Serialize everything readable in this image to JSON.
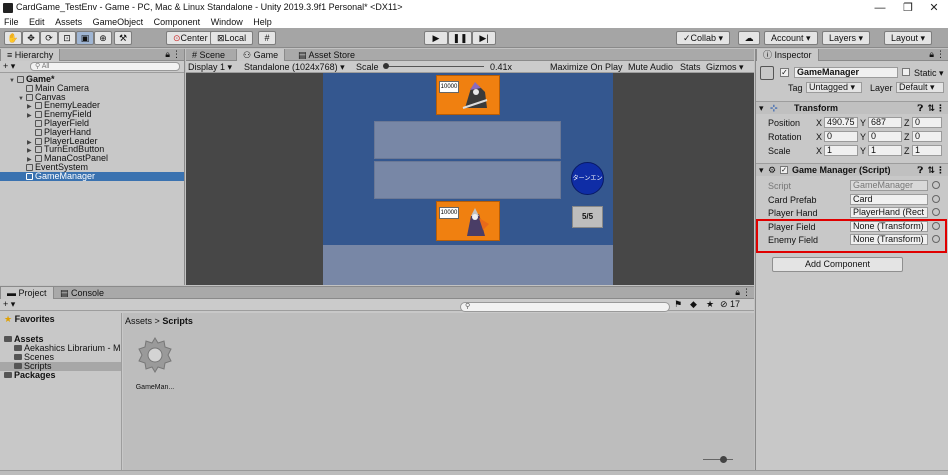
{
  "window": {
    "title": "CardGame_TestEnv - Game - PC, Mac & Linux Standalone - Unity 2019.3.9f1 Personal* <DX11>",
    "min": "—",
    "max": "❐",
    "close": "✕"
  },
  "menu": [
    "File",
    "Edit",
    "Assets",
    "GameObject",
    "Component",
    "Window",
    "Help"
  ],
  "toolbar": {
    "center": "Center",
    "local": "Local",
    "play": "▶",
    "pause": "❚❚",
    "step": "▶|",
    "collab": "Collab ▾",
    "account": "Account ▾",
    "layers": "Layers ▾",
    "layout": "Layout ▾"
  },
  "hierarchy": {
    "tab": "Hierarchy",
    "add": "+ ▾",
    "search_placeholder": "All",
    "items": [
      {
        "label": "Game*",
        "indent": 1,
        "type": "scene"
      },
      {
        "label": "Main Camera",
        "indent": 2,
        "type": "object"
      },
      {
        "label": "Canvas",
        "indent": 2,
        "type": "object"
      },
      {
        "label": "EnemyLeader",
        "indent": 3,
        "type": "object"
      },
      {
        "label": "EnemyField",
        "indent": 3,
        "type": "object"
      },
      {
        "label": "PlayerField",
        "indent": 3,
        "type": "object"
      },
      {
        "label": "PlayerHand",
        "indent": 3,
        "type": "object"
      },
      {
        "label": "PlayerLeader",
        "indent": 3,
        "type": "object"
      },
      {
        "label": "TurnEndButton",
        "indent": 3,
        "type": "object"
      },
      {
        "label": "ManaCostPanel",
        "indent": 3,
        "type": "object"
      },
      {
        "label": "EventSystem",
        "indent": 2,
        "type": "object"
      },
      {
        "label": "GameManager",
        "indent": 2,
        "type": "object"
      }
    ]
  },
  "game_view": {
    "tabs": [
      "Scene",
      "Game",
      "Asset Store"
    ],
    "display": "Display 1 ▾",
    "resolution": "Standalone (1024x768) ▾",
    "scale_label": "Scale",
    "scale_value": "0.41x",
    "options": [
      "Maximize On Play",
      "Mute Audio",
      "Stats",
      "Gizmos ▾"
    ],
    "enemy_card_cost": "10000",
    "player_card_cost": "10000",
    "turn_end_label": "ターンエンド",
    "mana": "5/5"
  },
  "inspector": {
    "tab": "Inspector",
    "object_name": "GameManager",
    "static": "Static ▾",
    "tag_label": "Tag",
    "tag_value": "Untagged ▾",
    "layer_label": "Layer",
    "layer_value": "Default ▾",
    "transform": {
      "title": "Transform",
      "position": {
        "label": "Position",
        "x": "490.75",
        "y": "687",
        "z": "0"
      },
      "rotation": {
        "label": "Rotation",
        "x": "0",
        "y": "0",
        "z": "0"
      },
      "scale": {
        "label": "Scale",
        "x": "1",
        "y": "1",
        "z": "1"
      }
    },
    "script_component": {
      "title": "Game Manager (Script)",
      "fields": [
        {
          "label": "Script",
          "value": "GameManager"
        },
        {
          "label": "Card Prefab",
          "value": "Card"
        },
        {
          "label": "Player Hand",
          "value": "PlayerHand (Rect"
        },
        {
          "label": "Player Field",
          "value": "None (Transform)"
        },
        {
          "label": "Enemy Field",
          "value": "None (Transform)"
        }
      ]
    },
    "add_component": "Add Component"
  },
  "project": {
    "tabs": [
      "Project",
      "Console"
    ],
    "add": "+ ▾",
    "count": "17",
    "tree": [
      {
        "label": "Favorites",
        "indent": 0
      },
      {
        "label": "Assets",
        "indent": 0
      },
      {
        "label": "Aekashics Librarium - M",
        "indent": 1
      },
      {
        "label": "Scenes",
        "indent": 1
      },
      {
        "label": "Scripts",
        "indent": 1
      },
      {
        "label": "Packages",
        "indent": 0
      }
    ],
    "breadcrumb_root": "Assets",
    "breadcrumb_sep": ">",
    "breadcrumb_current": "Scripts",
    "file_label": "GameMan..."
  }
}
